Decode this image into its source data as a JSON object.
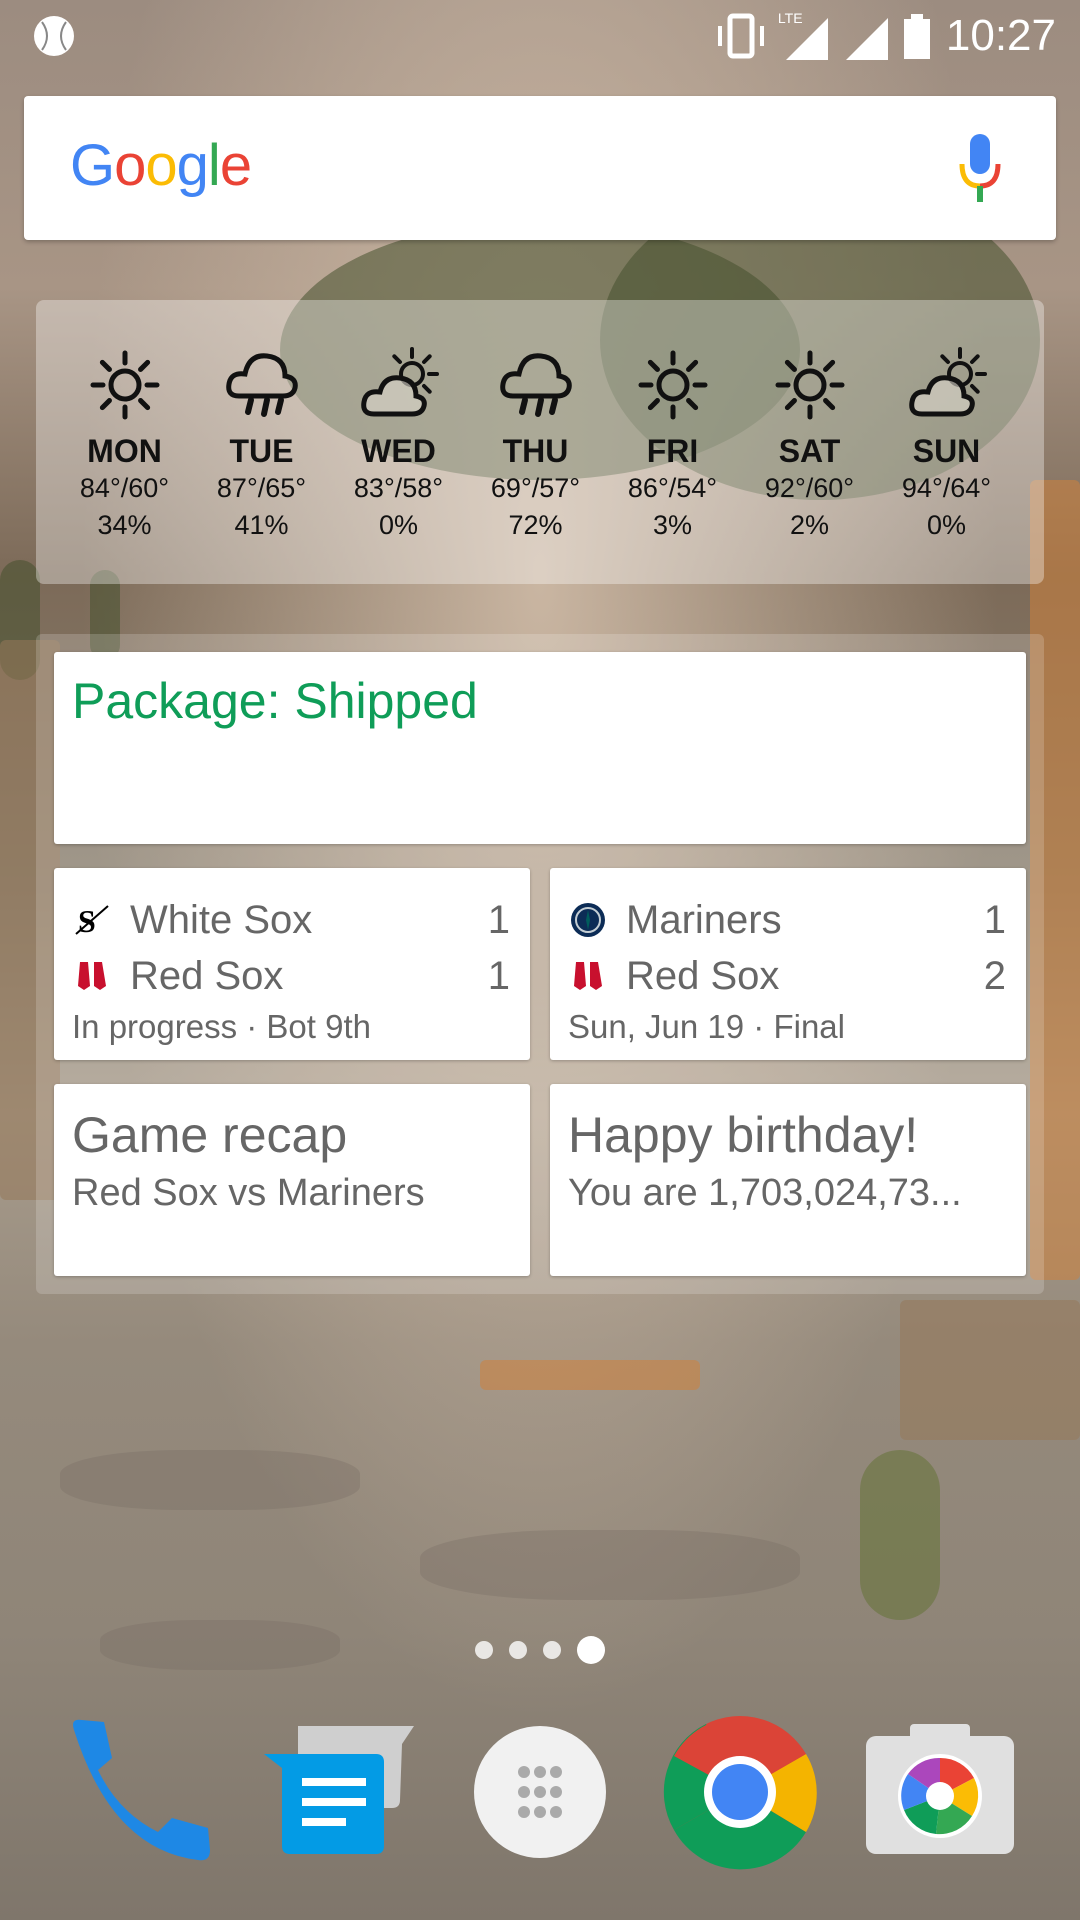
{
  "status_bar": {
    "time": "10:27",
    "network": "LTE"
  },
  "search": {
    "logo": "Google"
  },
  "weather": {
    "days": [
      {
        "day": "MON",
        "icon": "sunny-icon",
        "temps": "84°/60°",
        "precip": "34%"
      },
      {
        "day": "TUE",
        "icon": "rain-icon",
        "temps": "87°/65°",
        "precip": "41%"
      },
      {
        "day": "WED",
        "icon": "partly-cloudy-icon",
        "temps": "83°/58°",
        "precip": "0%"
      },
      {
        "day": "THU",
        "icon": "rain-icon",
        "temps": "69°/57°",
        "precip": "72%"
      },
      {
        "day": "FRI",
        "icon": "sunny-icon",
        "temps": "86°/54°",
        "precip": "3%"
      },
      {
        "day": "SAT",
        "icon": "sunny-icon",
        "temps": "92°/60°",
        "precip": "2%"
      },
      {
        "day": "SUN",
        "icon": "partly-cloudy-icon",
        "temps": "94°/64°",
        "precip": "0%"
      }
    ]
  },
  "cards": {
    "package": {
      "title": "Package: Shipped",
      "color": "#0f9d58"
    },
    "game1": {
      "team1": "White Sox",
      "score1": "1",
      "team2": "Red Sox",
      "score2": "1",
      "status": "In progress · Bot 9th"
    },
    "game2": {
      "team1": "Mariners",
      "score1": "1",
      "team2": "Red Sox",
      "score2": "2",
      "status": "Sun, Jun 19 · Final"
    },
    "recap": {
      "title": "Game recap",
      "subtitle": "Red Sox vs Mariners"
    },
    "birthday": {
      "title": "Happy birthday!",
      "subtitle": "You are 1,703,024,73..."
    }
  },
  "pager": {
    "pages": 4,
    "active": 4
  },
  "dock": [
    "phone-app",
    "messages-app",
    "app-drawer",
    "chrome-app",
    "camera-app"
  ]
}
